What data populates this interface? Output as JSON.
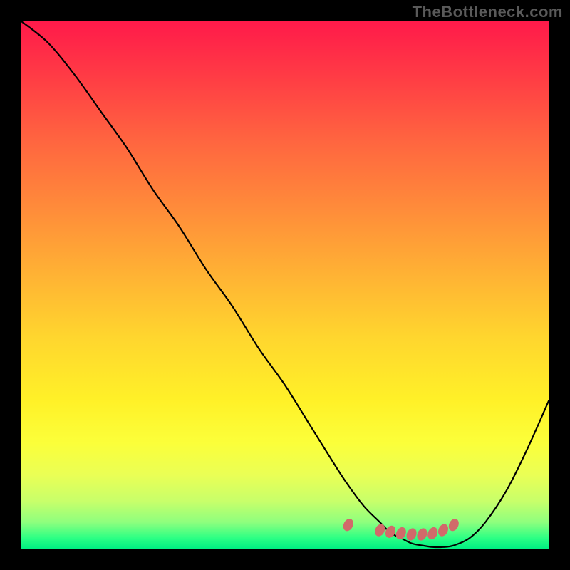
{
  "watermark": "TheBottleneck.com",
  "chart_data": {
    "type": "line",
    "title": "",
    "xlabel": "",
    "ylabel": "",
    "xlim": [
      0,
      100
    ],
    "ylim": [
      0,
      100
    ],
    "x": [
      0,
      5,
      10,
      15,
      20,
      25,
      30,
      35,
      40,
      45,
      50,
      55,
      60,
      62,
      65,
      68,
      70,
      72,
      74,
      76,
      78,
      80,
      82,
      85,
      88,
      92,
      96,
      100
    ],
    "values": [
      100,
      96,
      90,
      83,
      76,
      68,
      61,
      53,
      46,
      38,
      31,
      23,
      15,
      12,
      8,
      5,
      3,
      2,
      1,
      0.6,
      0.3,
      0.3,
      0.6,
      2,
      5,
      11,
      19,
      28
    ],
    "gradient_axis": "y",
    "gradient_stops": [
      {
        "value": 100,
        "color": "#ff1a4a"
      },
      {
        "value": 80,
        "color": "#ff6340"
      },
      {
        "value": 60,
        "color": "#ffb234"
      },
      {
        "value": 40,
        "color": "#fff128"
      },
      {
        "value": 20,
        "color": "#eaff55"
      },
      {
        "value": 5,
        "color": "#8eff7e"
      },
      {
        "value": 0,
        "color": "#00ef82"
      }
    ],
    "markers": {
      "x": [
        62,
        68,
        70,
        72,
        74,
        76,
        78,
        80,
        82
      ],
      "values": [
        4.5,
        3.5,
        3.2,
        2.9,
        2.7,
        2.7,
        2.9,
        3.5,
        4.5
      ],
      "color": "#d16a6a"
    }
  }
}
